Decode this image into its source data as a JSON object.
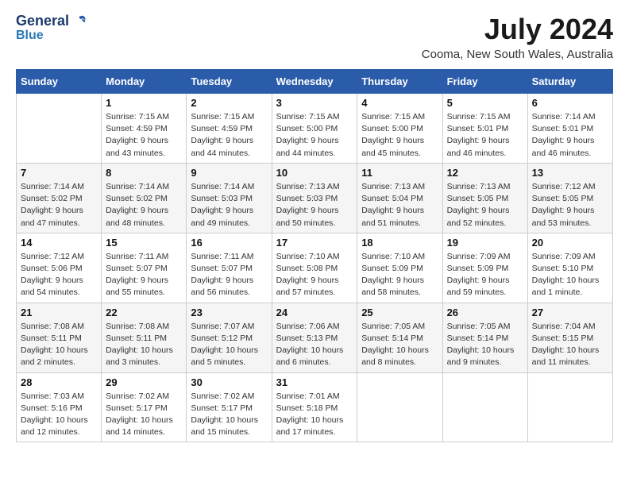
{
  "logo": {
    "line1": "General",
    "line2": "Blue"
  },
  "title": "July 2024",
  "location": "Cooma, New South Wales, Australia",
  "days_of_week": [
    "Sunday",
    "Monday",
    "Tuesday",
    "Wednesday",
    "Thursday",
    "Friday",
    "Saturday"
  ],
  "weeks": [
    [
      {
        "day": "",
        "info": ""
      },
      {
        "day": "1",
        "info": "Sunrise: 7:15 AM\nSunset: 4:59 PM\nDaylight: 9 hours\nand 43 minutes."
      },
      {
        "day": "2",
        "info": "Sunrise: 7:15 AM\nSunset: 4:59 PM\nDaylight: 9 hours\nand 44 minutes."
      },
      {
        "day": "3",
        "info": "Sunrise: 7:15 AM\nSunset: 5:00 PM\nDaylight: 9 hours\nand 44 minutes."
      },
      {
        "day": "4",
        "info": "Sunrise: 7:15 AM\nSunset: 5:00 PM\nDaylight: 9 hours\nand 45 minutes."
      },
      {
        "day": "5",
        "info": "Sunrise: 7:15 AM\nSunset: 5:01 PM\nDaylight: 9 hours\nand 46 minutes."
      },
      {
        "day": "6",
        "info": "Sunrise: 7:14 AM\nSunset: 5:01 PM\nDaylight: 9 hours\nand 46 minutes."
      }
    ],
    [
      {
        "day": "7",
        "info": "Sunrise: 7:14 AM\nSunset: 5:02 PM\nDaylight: 9 hours\nand 47 minutes."
      },
      {
        "day": "8",
        "info": "Sunrise: 7:14 AM\nSunset: 5:02 PM\nDaylight: 9 hours\nand 48 minutes."
      },
      {
        "day": "9",
        "info": "Sunrise: 7:14 AM\nSunset: 5:03 PM\nDaylight: 9 hours\nand 49 minutes."
      },
      {
        "day": "10",
        "info": "Sunrise: 7:13 AM\nSunset: 5:03 PM\nDaylight: 9 hours\nand 50 minutes."
      },
      {
        "day": "11",
        "info": "Sunrise: 7:13 AM\nSunset: 5:04 PM\nDaylight: 9 hours\nand 51 minutes."
      },
      {
        "day": "12",
        "info": "Sunrise: 7:13 AM\nSunset: 5:05 PM\nDaylight: 9 hours\nand 52 minutes."
      },
      {
        "day": "13",
        "info": "Sunrise: 7:12 AM\nSunset: 5:05 PM\nDaylight: 9 hours\nand 53 minutes."
      }
    ],
    [
      {
        "day": "14",
        "info": "Sunrise: 7:12 AM\nSunset: 5:06 PM\nDaylight: 9 hours\nand 54 minutes."
      },
      {
        "day": "15",
        "info": "Sunrise: 7:11 AM\nSunset: 5:07 PM\nDaylight: 9 hours\nand 55 minutes."
      },
      {
        "day": "16",
        "info": "Sunrise: 7:11 AM\nSunset: 5:07 PM\nDaylight: 9 hours\nand 56 minutes."
      },
      {
        "day": "17",
        "info": "Sunrise: 7:10 AM\nSunset: 5:08 PM\nDaylight: 9 hours\nand 57 minutes."
      },
      {
        "day": "18",
        "info": "Sunrise: 7:10 AM\nSunset: 5:09 PM\nDaylight: 9 hours\nand 58 minutes."
      },
      {
        "day": "19",
        "info": "Sunrise: 7:09 AM\nSunset: 5:09 PM\nDaylight: 9 hours\nand 59 minutes."
      },
      {
        "day": "20",
        "info": "Sunrise: 7:09 AM\nSunset: 5:10 PM\nDaylight: 10 hours\nand 1 minute."
      }
    ],
    [
      {
        "day": "21",
        "info": "Sunrise: 7:08 AM\nSunset: 5:11 PM\nDaylight: 10 hours\nand 2 minutes."
      },
      {
        "day": "22",
        "info": "Sunrise: 7:08 AM\nSunset: 5:11 PM\nDaylight: 10 hours\nand 3 minutes."
      },
      {
        "day": "23",
        "info": "Sunrise: 7:07 AM\nSunset: 5:12 PM\nDaylight: 10 hours\nand 5 minutes."
      },
      {
        "day": "24",
        "info": "Sunrise: 7:06 AM\nSunset: 5:13 PM\nDaylight: 10 hours\nand 6 minutes."
      },
      {
        "day": "25",
        "info": "Sunrise: 7:05 AM\nSunset: 5:14 PM\nDaylight: 10 hours\nand 8 minutes."
      },
      {
        "day": "26",
        "info": "Sunrise: 7:05 AM\nSunset: 5:14 PM\nDaylight: 10 hours\nand 9 minutes."
      },
      {
        "day": "27",
        "info": "Sunrise: 7:04 AM\nSunset: 5:15 PM\nDaylight: 10 hours\nand 11 minutes."
      }
    ],
    [
      {
        "day": "28",
        "info": "Sunrise: 7:03 AM\nSunset: 5:16 PM\nDaylight: 10 hours\nand 12 minutes."
      },
      {
        "day": "29",
        "info": "Sunrise: 7:02 AM\nSunset: 5:17 PM\nDaylight: 10 hours\nand 14 minutes."
      },
      {
        "day": "30",
        "info": "Sunrise: 7:02 AM\nSunset: 5:17 PM\nDaylight: 10 hours\nand 15 minutes."
      },
      {
        "day": "31",
        "info": "Sunrise: 7:01 AM\nSunset: 5:18 PM\nDaylight: 10 hours\nand 17 minutes."
      },
      {
        "day": "",
        "info": ""
      },
      {
        "day": "",
        "info": ""
      },
      {
        "day": "",
        "info": ""
      }
    ]
  ]
}
